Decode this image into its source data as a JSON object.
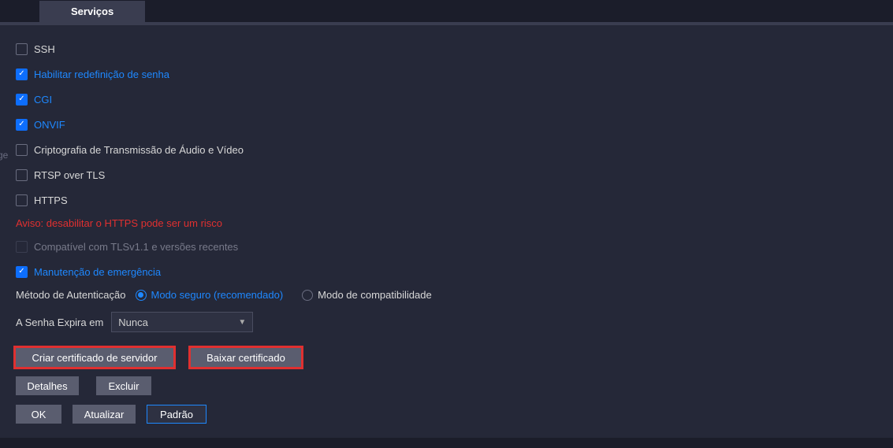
{
  "tab": {
    "label": "Serviços"
  },
  "checkboxes": {
    "ssh": {
      "label": "SSH",
      "checked": false
    },
    "reset_password": {
      "label": "Habilitar redefinição de senha",
      "checked": true
    },
    "cgi": {
      "label": "CGI",
      "checked": true
    },
    "onvif": {
      "label": "ONVIF",
      "checked": true
    },
    "av_encryption": {
      "label": "Criptografia de Transmissão de Áudio e Vídeo",
      "checked": false
    },
    "rtsp_tls": {
      "label": "RTSP over TLS",
      "checked": false
    },
    "https": {
      "label": "HTTPS",
      "checked": false
    },
    "tls_compat": {
      "label": "Compatível com TLSv1.1 e versões recentes",
      "checked": false
    },
    "emergency": {
      "label": "Manutenção de emergência",
      "checked": true
    }
  },
  "warning": "Aviso: desabilitar o HTTPS pode ser um risco",
  "auth": {
    "label": "Método de Autenticação",
    "options": {
      "secure": "Modo seguro (recomendado)",
      "compat": "Modo de compatibilidade"
    },
    "selected": "secure"
  },
  "expire": {
    "label": "A Senha Expira em",
    "value": "Nunca"
  },
  "buttons": {
    "create_cert": "Criar certificado de servidor",
    "download_cert": "Baixar certificado",
    "details": "Detalhes",
    "delete": "Excluir",
    "ok": "OK",
    "refresh": "Atualizar",
    "default": "Padrão"
  },
  "side_text": "ge"
}
